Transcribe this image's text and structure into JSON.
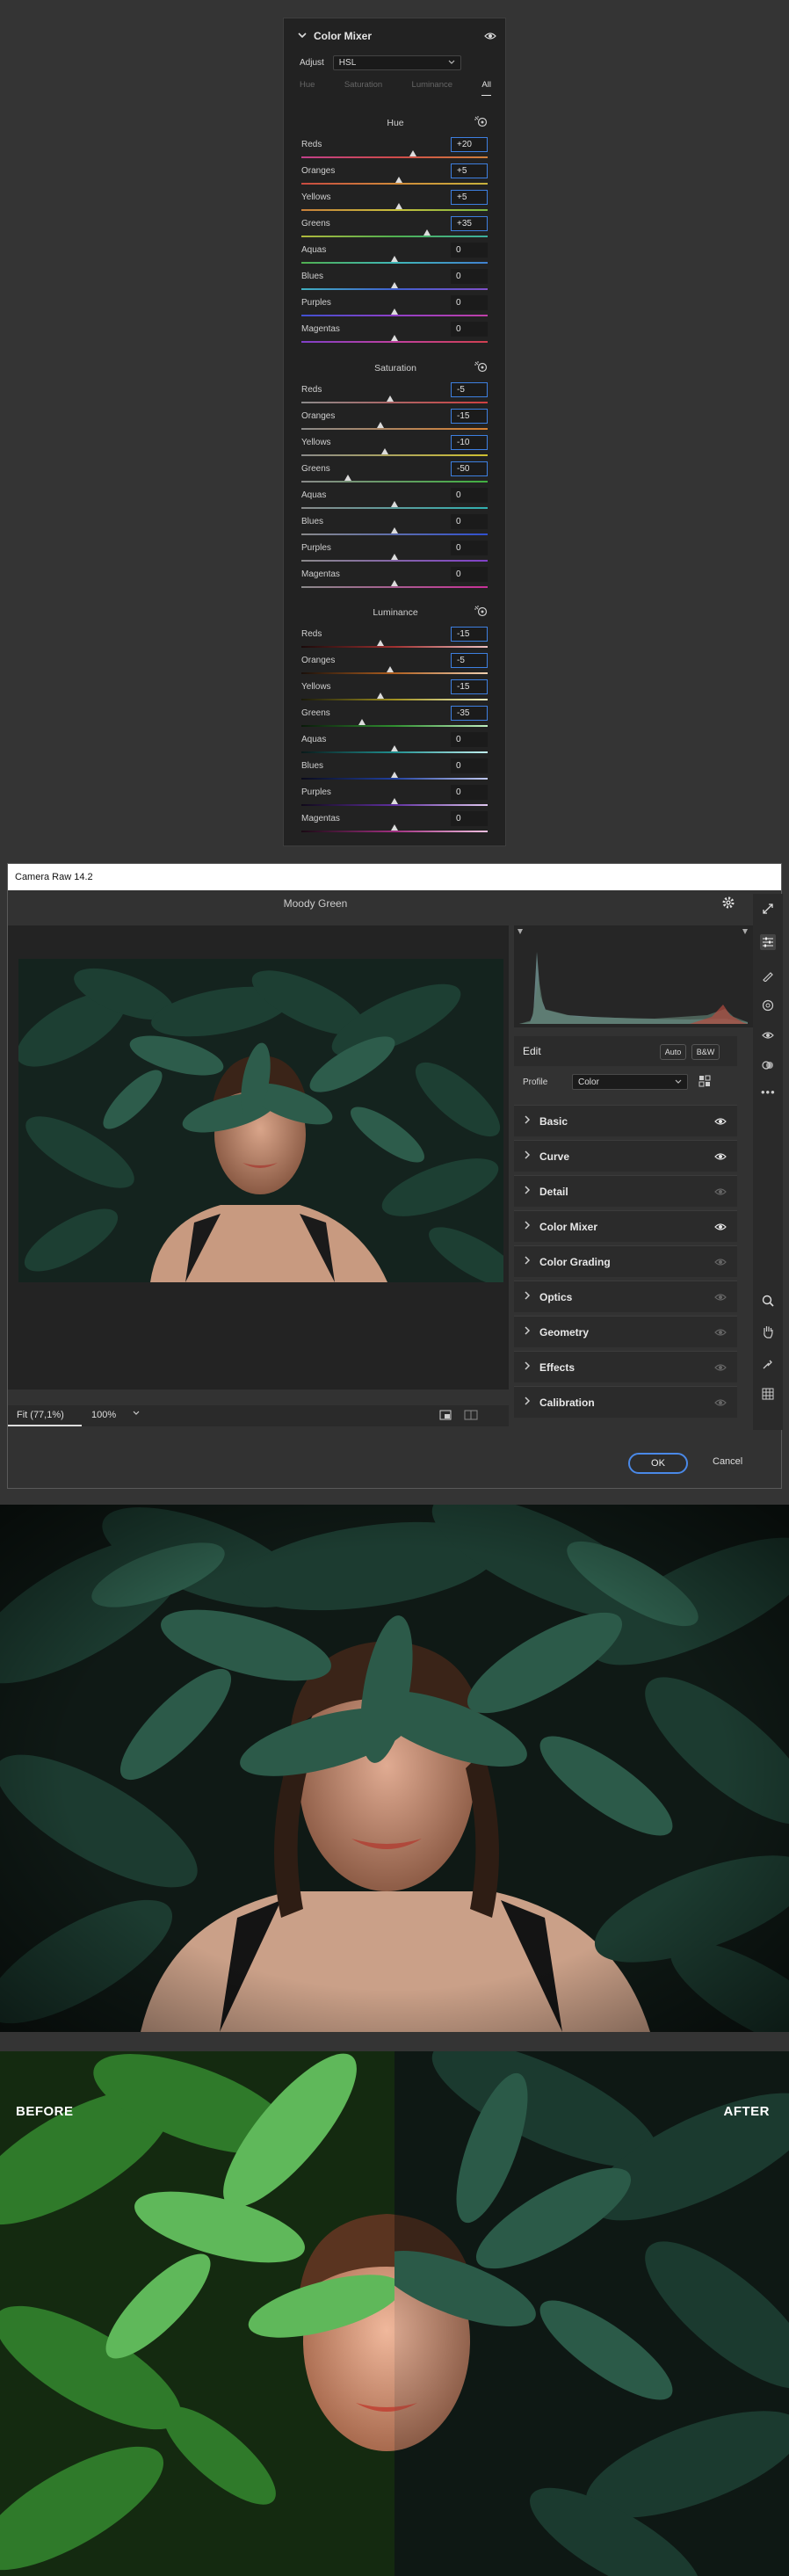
{
  "mixer": {
    "title": "Color Mixer",
    "adjust_label": "Adjust",
    "adjust_value": "HSL",
    "tabs": [
      "Hue",
      "Saturation",
      "Luminance",
      "All"
    ],
    "active_tab": "All",
    "hue": {
      "title": "Hue",
      "rows": [
        {
          "label": "Reds",
          "value": "+20",
          "num": 20,
          "hl": true
        },
        {
          "label": "Oranges",
          "value": "+5",
          "num": 5,
          "hl": true
        },
        {
          "label": "Yellows",
          "value": "+5",
          "num": 5,
          "hl": true
        },
        {
          "label": "Greens",
          "value": "+35",
          "num": 35,
          "hl": true
        },
        {
          "label": "Aquas",
          "value": "0",
          "num": 0,
          "hl": false
        },
        {
          "label": "Blues",
          "value": "0",
          "num": 0,
          "hl": false
        },
        {
          "label": "Purples",
          "value": "0",
          "num": 0,
          "hl": false
        },
        {
          "label": "Magentas",
          "value": "0",
          "num": 0,
          "hl": false
        }
      ]
    },
    "saturation": {
      "title": "Saturation",
      "rows": [
        {
          "label": "Reds",
          "value": "-5",
          "num": -5,
          "hl": true
        },
        {
          "label": "Oranges",
          "value": "-15",
          "num": -15,
          "hl": true
        },
        {
          "label": "Yellows",
          "value": "-10",
          "num": -10,
          "hl": true
        },
        {
          "label": "Greens",
          "value": "-50",
          "num": -50,
          "hl": true
        },
        {
          "label": "Aquas",
          "value": "0",
          "num": 0,
          "hl": false
        },
        {
          "label": "Blues",
          "value": "0",
          "num": 0,
          "hl": false
        },
        {
          "label": "Purples",
          "value": "0",
          "num": 0,
          "hl": false
        },
        {
          "label": "Magentas",
          "value": "0",
          "num": 0,
          "hl": false
        }
      ]
    },
    "luminance": {
      "title": "Luminance",
      "rows": [
        {
          "label": "Reds",
          "value": "-15",
          "num": -15,
          "hl": true
        },
        {
          "label": "Oranges",
          "value": "-5",
          "num": -5,
          "hl": true
        },
        {
          "label": "Yellows",
          "value": "-15",
          "num": -15,
          "hl": true
        },
        {
          "label": "Greens",
          "value": "-35",
          "num": -35,
          "hl": true
        },
        {
          "label": "Aquas",
          "value": "0",
          "num": 0,
          "hl": false
        },
        {
          "label": "Blues",
          "value": "0",
          "num": 0,
          "hl": false
        },
        {
          "label": "Purples",
          "value": "0",
          "num": 0,
          "hl": false
        },
        {
          "label": "Magentas",
          "value": "0",
          "num": 0,
          "hl": false
        }
      ]
    }
  },
  "camera_raw": {
    "window_title": "Camera Raw 14.2",
    "preset_name": "Moody Green",
    "edit_label": "Edit",
    "auto_label": "Auto",
    "bw_label": "B&W",
    "profile_label": "Profile",
    "profile_value": "Color",
    "sections": [
      "Basic",
      "Curve",
      "Detail",
      "Color Mixer",
      "Color Grading",
      "Optics",
      "Geometry",
      "Effects",
      "Calibration"
    ],
    "fit_label": "Fit (77,1%)",
    "zoom_label": "100%",
    "ok_label": "OK",
    "cancel_label": "Cancel"
  },
  "comparison": {
    "before_label": "BEFORE",
    "after_label": "AFTER"
  },
  "colors": {
    "accent_blue": "#3d7fe0",
    "panel_bg": "#222222",
    "page_bg": "#343434"
  }
}
